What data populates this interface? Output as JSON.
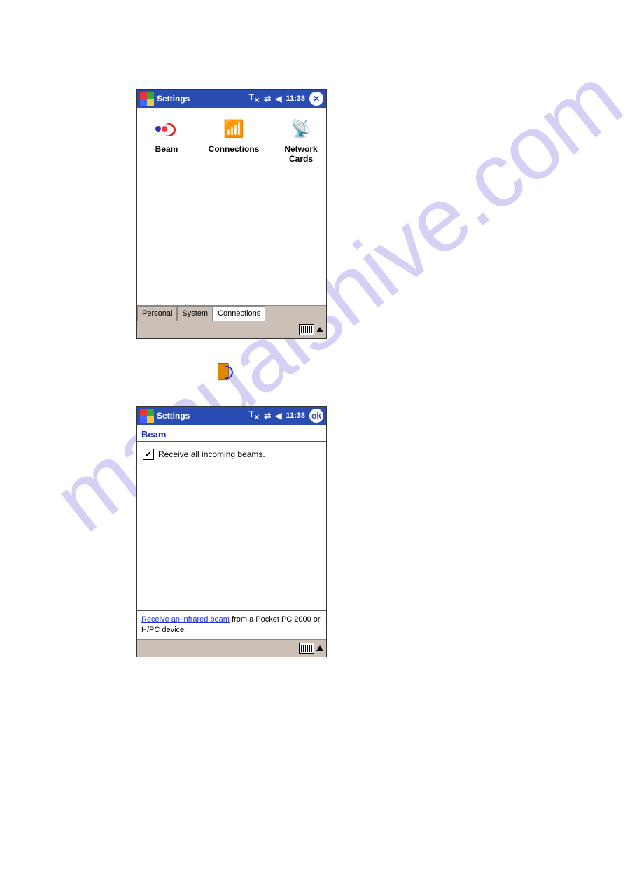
{
  "watermark": "manualshive.com",
  "titlebar": {
    "title": "Settings",
    "time": "11:38",
    "close_glyph": "✕",
    "ok_glyph": "ok"
  },
  "settings_icons": {
    "beam": "Beam",
    "connections": "Connections",
    "network_cards": "Network\nCards"
  },
  "tabs": {
    "personal": "Personal",
    "system": "System",
    "connections": "Connections"
  },
  "beam_screen": {
    "heading": "Beam",
    "checkbox_label": "Receive all incoming beams.",
    "link_text": "Receive an infrared beam",
    "note_rest": " from a Pocket PC 2000 or H/PC device."
  }
}
